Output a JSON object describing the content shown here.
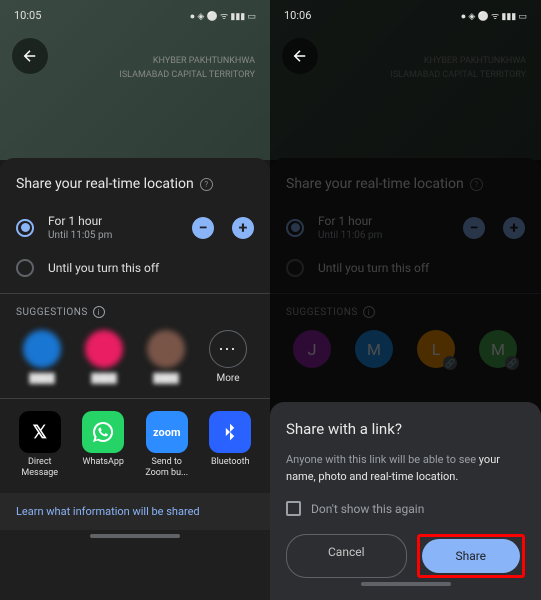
{
  "left": {
    "time": "10:05",
    "map_label1": "KHYBER PAKHTUNKHWA",
    "map_label2": "ISLAMABAD CAPITAL TERRITORY",
    "sheet_title": "Share your real-time location",
    "opt1_title": "For 1 hour",
    "opt1_sub": "Until 11:05 pm",
    "opt2_title": "Until you turn this off",
    "suggestions_label": "SUGGESTIONS",
    "more_label": "More",
    "apps": {
      "direct": "Direct Message",
      "whatsapp": "WhatsApp",
      "zoom": "Send to Zoom bu...",
      "bluetooth": "Bluetooth"
    },
    "learn_link": "Learn what information will be shared"
  },
  "right": {
    "time": "10:06",
    "map_label1": "KHYBER PAKHTUNKHWA",
    "map_label2": "ISLAMABAD CAPITAL TERRITORY",
    "sheet_title": "Share your real-time location",
    "opt1_title": "For 1 hour",
    "opt1_sub": "Until 11:06 pm",
    "opt2_title": "Until you turn this off",
    "suggestions_label": "SUGGESTIONS",
    "contacts": [
      "J",
      "M",
      "L",
      "M"
    ],
    "contact_colors": [
      "#9c27b0",
      "#2196f3",
      "#ff9800",
      "#4caf50"
    ],
    "modal_title": "Share with a link?",
    "modal_body_a": "Anyone with this link will be able to see ",
    "modal_body_b": "your name, photo and real-time location.",
    "checkbox_label": "Don't show this again",
    "cancel": "Cancel",
    "share": "Share"
  }
}
